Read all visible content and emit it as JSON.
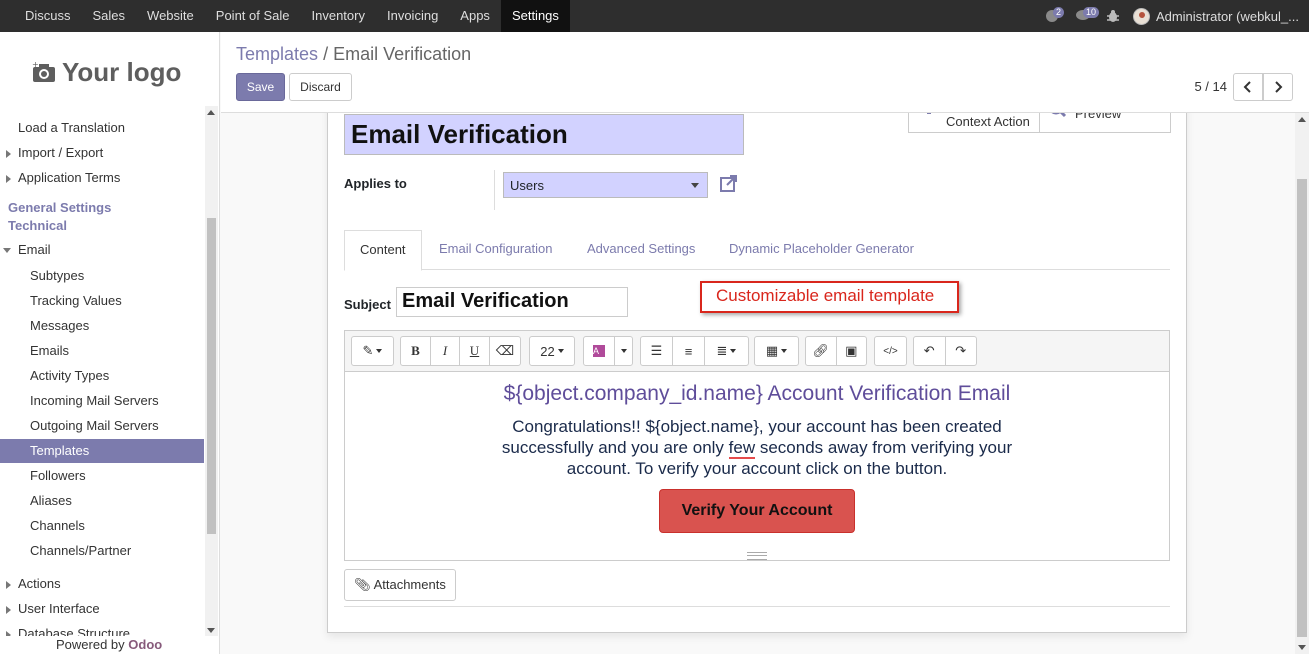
{
  "topnav": {
    "menu": [
      "Discuss",
      "Sales",
      "Website",
      "Point of Sale",
      "Inventory",
      "Invoicing",
      "Apps",
      "Settings"
    ],
    "active": "Settings",
    "chat_count": "2",
    "activity_count": "10",
    "user": "Administrator (webkul_..."
  },
  "sidebar": {
    "logo_text": "Your logo",
    "items": {
      "load_translation": "Load a Translation",
      "import_export": "Import / Export",
      "application_terms": "Application Terms",
      "general_settings": "General Settings",
      "technical": "Technical",
      "email": "Email",
      "subtypes": "Subtypes",
      "tracking_values": "Tracking Values",
      "messages": "Messages",
      "emails": "Emails",
      "activity_types": "Activity Types",
      "incoming_mail": "Incoming Mail Servers",
      "outgoing_mail": "Outgoing Mail Servers",
      "templates": "Templates",
      "followers": "Followers",
      "aliases": "Aliases",
      "channels": "Channels",
      "channels_partner": "Channels/Partner",
      "actions": "Actions",
      "user_interface": "User Interface",
      "database_structure": "Database Structure"
    },
    "powered_prefix": "Powered by",
    "powered_brand": "Odoo"
  },
  "control": {
    "breadcrumb_parent": "Templates",
    "breadcrumb_sep": "/",
    "breadcrumb_current": "Email Verification",
    "save_label": "Save",
    "discard_label": "Discard",
    "pager": "5 / 14"
  },
  "form": {
    "name": "Email Verification",
    "smart_context": "Context Action",
    "smart_preview": "Preview",
    "applies_label": "Applies to",
    "applies_value": "Users",
    "tabs": [
      "Content",
      "Email Configuration",
      "Advanced Settings",
      "Dynamic Placeholder Generator"
    ],
    "subject_label": "Subject",
    "subject_value": "Email Verification",
    "annotation": "Customizable email template",
    "toolbar_font_size": "22",
    "body_title": "${object.company_id.name} Account Verification Email",
    "body_text_1": "Congratulations!! ${object.name}, your account has been created successfully and you are only ",
    "body_text_few": "few",
    "body_text_2": " seconds away from verifying your account. To verify your account click on the button.",
    "verify_button": "Verify Your Account",
    "attachments_label": "Attachments"
  },
  "colors": {
    "accent": "#7c7bad",
    "topbar": "#2e2e2e",
    "required_field": "#d2d2ff",
    "verify_button": "#d9534f",
    "annotation": "#d9261c"
  }
}
